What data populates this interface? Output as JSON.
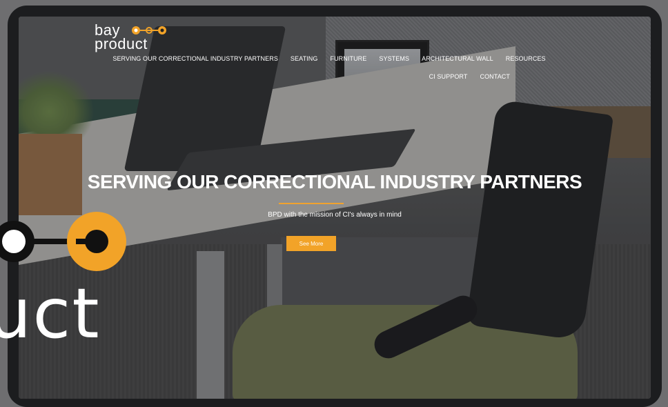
{
  "header": {
    "logo_line1": "bay",
    "logo_line2": "product"
  },
  "nav": {
    "row1": [
      "SERVING OUR CORRECTIONAL INDUSTRY PARTNERS",
      "SEATING",
      "FURNITURE",
      "SYSTEMS",
      "ARCHITECTURAL WALL",
      "RESOURCES"
    ],
    "row2": [
      "CI SUPPORT",
      "CONTACT"
    ]
  },
  "hero": {
    "title": "SERVING OUR CORRECTIONAL INDUSTRY PARTNERS",
    "subtitle": "BPD with the mission of CI's always in mind",
    "cta": "See More"
  },
  "big_logo": {
    "fragment": "uct"
  },
  "colors": {
    "accent": "#f2a328",
    "text": "#ffffff",
    "bezel": "#1c1d1f"
  }
}
